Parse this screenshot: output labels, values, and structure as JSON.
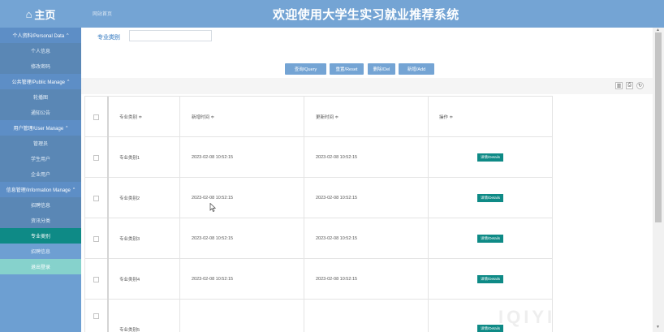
{
  "topbar": {
    "home_icon": "home-icon",
    "home_label": "主页",
    "breadcrumb": "网站首页",
    "app_title": "欢迎使用大学生实习就业推荐系统"
  },
  "sidebar": {
    "menu": [
      {
        "type": "group",
        "label": "个人资料/Personal Data",
        "chevron": "^"
      },
      {
        "type": "item",
        "label": "个人信息"
      },
      {
        "type": "item",
        "label": "修改密码"
      },
      {
        "type": "group",
        "label": "公共管理/Public Manage",
        "chevron": "^"
      },
      {
        "type": "item",
        "label": "轮播图"
      },
      {
        "type": "item",
        "label": "通知公告"
      },
      {
        "type": "group",
        "label": "用户管理/User Manage",
        "chevron": "^"
      },
      {
        "type": "item",
        "label": "管理员"
      },
      {
        "type": "item",
        "label": "学生用户"
      },
      {
        "type": "item",
        "label": "企业用户"
      },
      {
        "type": "group",
        "label": "信息管理/Information Manage",
        "chevron": "^"
      },
      {
        "type": "item",
        "label": "招聘信息"
      },
      {
        "type": "item",
        "label": "资讯分类"
      },
      {
        "type": "item",
        "label": "专业类别",
        "state": "active"
      },
      {
        "type": "item",
        "label": "招聘信息",
        "state": "light"
      },
      {
        "type": "item",
        "label": "退出登录",
        "state": "teal"
      }
    ]
  },
  "filter": {
    "label": "专业类别",
    "value": ""
  },
  "buttons": {
    "query": "查询/Query",
    "reset": "重置/Reset",
    "delete": "删除/Del",
    "add": "新增/Add"
  },
  "toolbar_icons": [
    "columns-icon",
    "print-icon",
    "refresh-icon"
  ],
  "table": {
    "headers": [
      "专业类别 ≑",
      "新增时间 ≑",
      "更新时间 ≑",
      "操作 ≑"
    ],
    "detail_label": "详情/Details",
    "rows": [
      {
        "category": "专业类别1",
        "created": "2023-02-08 10:52:15",
        "updated": "2023-02-08 10:52:15"
      },
      {
        "category": "专业类别2",
        "created": "2023-02-08 10:52:15",
        "updated": "2023-02-08 10:52:15"
      },
      {
        "category": "专业类别3",
        "created": "2023-02-08 10:52:15",
        "updated": "2023-02-08 10:52:15"
      },
      {
        "category": "专业类别4",
        "created": "2023-02-08 10:52:15",
        "updated": "2023-02-08 10:52:15"
      },
      {
        "category": "专业类别5",
        "created": "",
        "updated": ""
      }
    ]
  },
  "watermark": "IQIYI",
  "colors": {
    "brand_blue": "#74a4d4",
    "sidebar_dark": "#5a87b5",
    "active_teal": "#0e8a86",
    "logout_teal": "#86d2cc"
  }
}
